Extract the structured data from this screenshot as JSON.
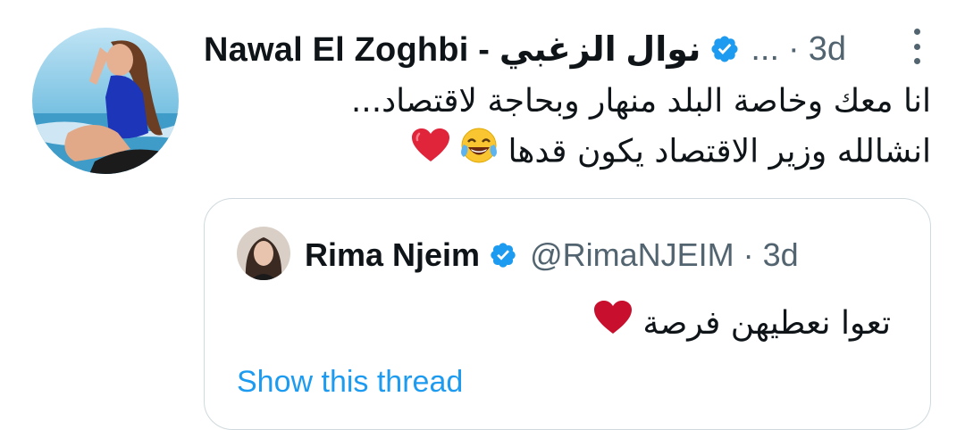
{
  "tweet": {
    "display_name": "Nawal El Zoghbi - نوال الزغبي",
    "handle": "...",
    "separator": "·",
    "time": "3d",
    "text_line1": "انا معك وخاصة البلد منهار وبحاجة لاقتصاد...",
    "text_line2": "انشالله وزير الاقتصاد يكون قدها",
    "emojis": [
      "face-with-tears-of-joy-icon",
      "red-heart-icon"
    ]
  },
  "quoted_tweet": {
    "display_name": "Rima Njeim",
    "handle": "@RimaNJEIM",
    "separator": "·",
    "time": "3d",
    "text": "تعوا نعطيهن فرصة",
    "show_thread_label": "Show this thread"
  },
  "colors": {
    "verified": "#1d9bf0",
    "link": "#1d9bf0",
    "secondary_text": "#536471",
    "heart": "#e0243a",
    "border": "#cfd9de"
  }
}
